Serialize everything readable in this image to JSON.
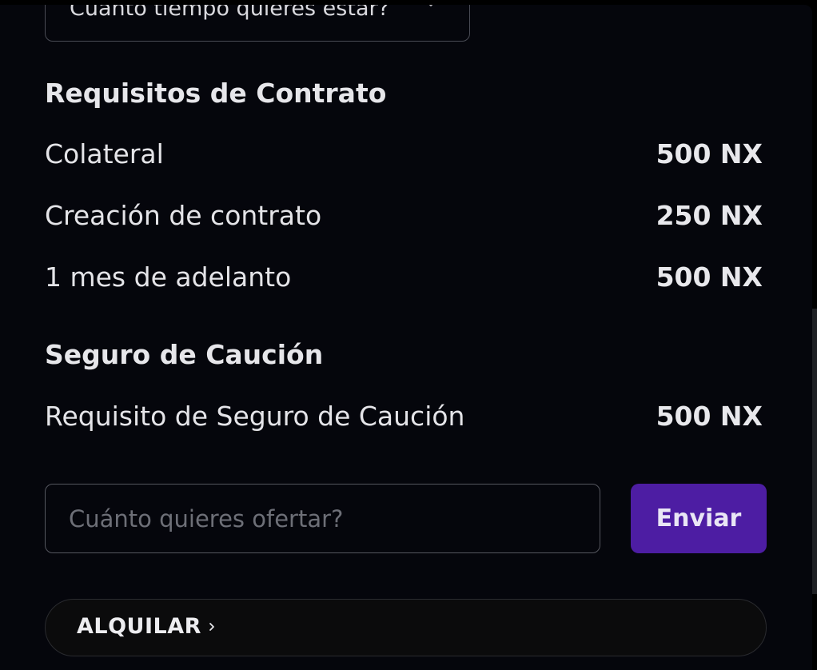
{
  "duration_select": {
    "value": "Cuánto tiempo quieres estar?",
    "icon": "chevron-down-icon"
  },
  "contract_requirements": {
    "title": "Requisitos de Contrato",
    "rows": [
      {
        "label": "Colateral",
        "value": "500 NX"
      },
      {
        "label": "Creación de contrato",
        "value": "250 NX"
      },
      {
        "label": "1 mes de adelanto",
        "value": "500 NX"
      }
    ]
  },
  "surety_insurance": {
    "title": "Seguro de Caución",
    "rows": [
      {
        "label": "Requisito de Seguro de Caución",
        "value": "500 NX"
      }
    ]
  },
  "offer": {
    "placeholder": "Cuánto quieres ofertar?",
    "value": "",
    "submit_label": "Enviar"
  },
  "rent": {
    "label": "ALQUILAR",
    "icon": "chevron-right-icon"
  },
  "colors": {
    "background": "#05060c",
    "accent": "#4d1da3",
    "text": "#e4e4e8",
    "muted": "#6d6f77",
    "border": "#55575f"
  }
}
